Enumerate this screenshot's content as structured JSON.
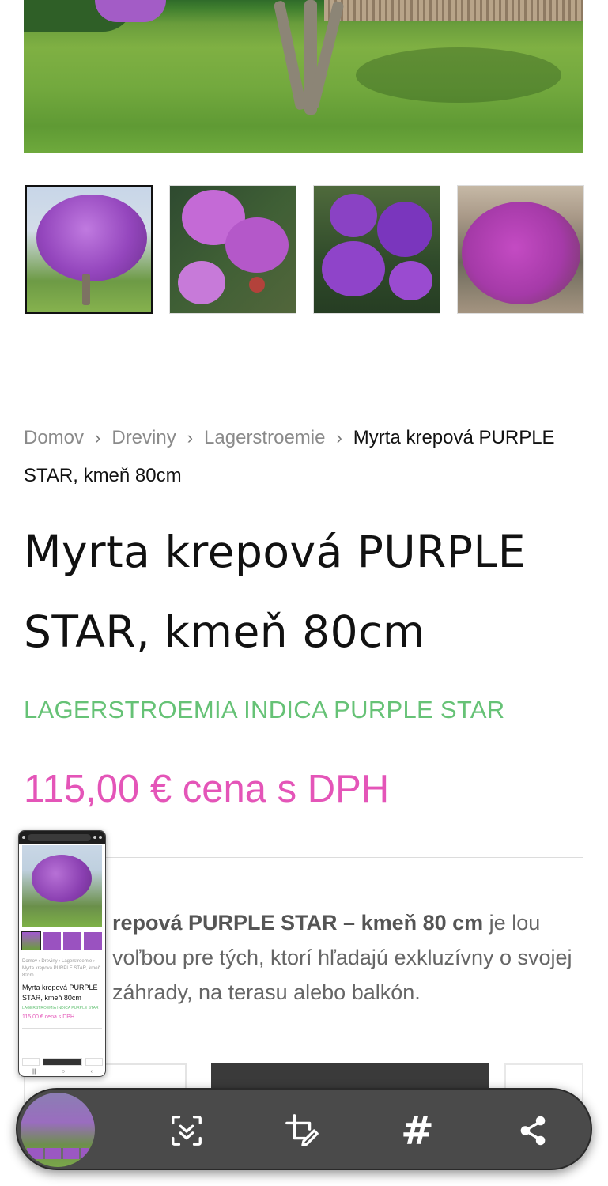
{
  "breadcrumb": {
    "items": [
      "Domov",
      "Dreviny",
      "Lagerstroemie"
    ],
    "current": "Myrta krepová PURPLE STAR, kmeň 80cm"
  },
  "product": {
    "title": "Myrta krepová PURPLE STAR, kmeň 80cm",
    "latin_name": "LAGERSTROEMIA INDICA PURPLE STAR",
    "price": "115,00 € cena s DPH",
    "description_bold": "repová PURPLE STAR – kmeň 80 cm",
    "description_rest": " je lou voľbou pre tých, ktorí hľadajú exkluzívny o svojej záhrady, na terasu alebo balkón."
  },
  "gallery": {
    "thumbnails": [
      "lagerstroemia-tree",
      "flower-closeup",
      "purple-bush",
      "field-bush"
    ],
    "active_index": 0
  },
  "preview": {
    "breadcrumb": "Domov › Dreviny › Lagerstroemie › Myrta krepová PURPLE STAR, kmeň 80cm",
    "title": "Myrta krepová PURPLE STAR, kmeň 80cm",
    "latin": "LAGERSTROEMIA INDICA PURPLE STAR",
    "price": "115,00 € cena s DPH"
  },
  "toolbar": {
    "icons": [
      "scroll-capture-icon",
      "crop-edit-icon",
      "hashtag-icon",
      "share-icon"
    ],
    "hashtag_glyph": "#"
  },
  "colors": {
    "latin_green": "#66c276",
    "price_pink": "#e455b8",
    "toolbar_bg": "#4a4a4a",
    "cart_button": "#3a3a3a"
  }
}
